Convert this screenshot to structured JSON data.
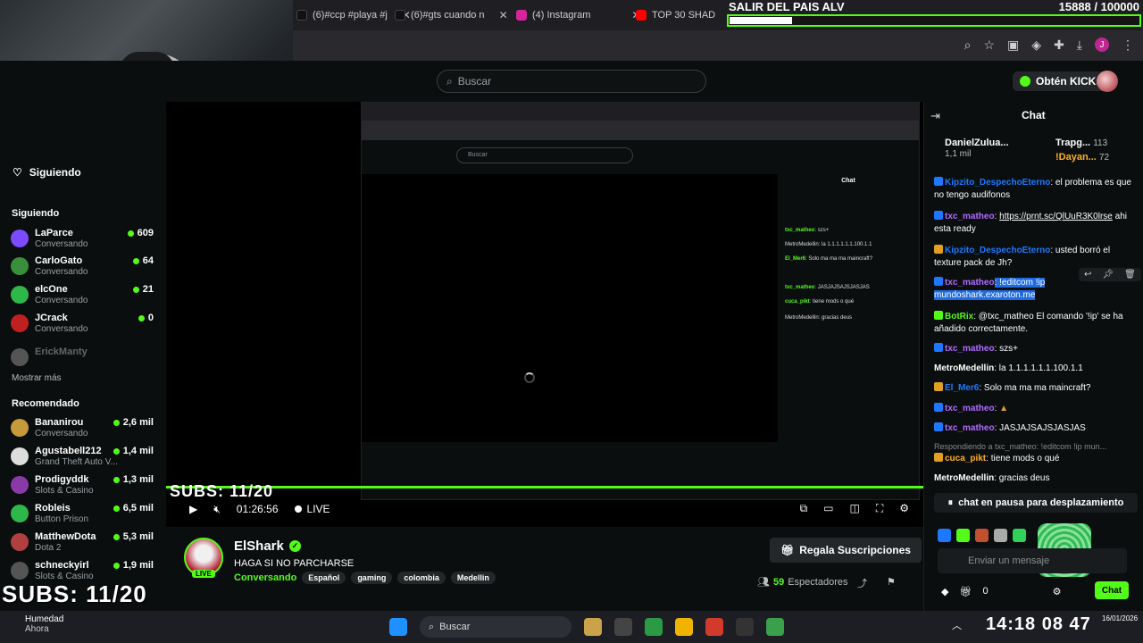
{
  "browser": {
    "tabs": [
      {
        "label": "(6)#ccp #playa #j",
        "color": "#111"
      },
      {
        "label": "(6)#gts cuando n",
        "color": "#111"
      },
      {
        "label": "(4) Instagram",
        "color": "#d6249f"
      },
      {
        "label": "TOP 30 SHAD",
        "color": "#ff0000"
      }
    ],
    "avatar_letter": "J"
  },
  "overlay": {
    "goal_title": "SALIR DEL PAIS ALV",
    "goal_count": "15888 / 100000"
  },
  "header": {
    "search_placeholder": "Buscar",
    "get_kicks": "Obtén KICKs"
  },
  "sidebar": {
    "following_header": "Siguiendo",
    "following_title": "Siguiendo",
    "following": [
      {
        "name": "LaParce",
        "sub": "Conversando",
        "count": "609",
        "color": "#7b4bff"
      },
      {
        "name": "CarloGato",
        "sub": "Conversando",
        "count": "64",
        "color": "#3a8f3a"
      },
      {
        "name": "elcOne",
        "sub": "Conversando",
        "count": "21",
        "color": "#2fb84a"
      },
      {
        "name": "JCrack",
        "sub": "Conversando",
        "count": "0",
        "color": "#c02020"
      },
      {
        "name": "ErickManty",
        "sub": "",
        "count": "",
        "color": "#555"
      }
    ],
    "show_more": "Mostrar más",
    "recommended_title": "Recomendado",
    "recommended": [
      {
        "name": "Bananirou",
        "sub": "Conversando",
        "count": "2,6 mil",
        "color": "#c49a3a"
      },
      {
        "name": "Agustabell212",
        "sub": "Grand Theft Auto V...",
        "count": "1,4 mil",
        "color": "#ddd"
      },
      {
        "name": "Prodigyddk",
        "sub": "Slots & Casino",
        "count": "1,3 mil",
        "color": "#8a3aa8"
      },
      {
        "name": "Robleis",
        "sub": "Button Prison",
        "count": "6,5 mil",
        "color": "#2fb84a"
      },
      {
        "name": "MatthewDota",
        "sub": "Dota 2",
        "count": "5,3 mil",
        "color": "#b04040"
      },
      {
        "name": "schneckyirl",
        "sub": "Slots & Casino",
        "count": "1,9 mil",
        "color": "#555"
      }
    ]
  },
  "player": {
    "subs_text": "SUBS: 11/20",
    "time": "01:26:56",
    "live": "LIVE"
  },
  "stream": {
    "name": "ElShark",
    "title": "HAGA SI NO PARCHARSE",
    "category": "Conversando",
    "tags": [
      "Español",
      "gaming",
      "colombia",
      "Medellin"
    ],
    "gift_button": "Regala Suscripciones",
    "viewers": "59",
    "viewers_label": "Espectadores",
    "live_badge": "LIVE",
    "subs_overlay": "SUBS: 11/20"
  },
  "chat": {
    "title": "Chat",
    "donors": [
      {
        "name": "DanielZulua...",
        "amount": "1,1 mil"
      },
      {
        "name": "Trapg...",
        "amount": "113"
      },
      {
        "name": "!Dayan...",
        "amount": "72"
      }
    ],
    "messages": [
      {
        "user": "Kipzito_DespechoEterno",
        "text": ": el problema es que no tengo audifonos",
        "ucolor": "#1e78ff"
      },
      {
        "user": "txc_matheo",
        "text": ": ",
        "link": "https://prnt.sc/QlUuR3K0lrse",
        "after": " ahi esta ready",
        "ucolor": "#b06bff"
      },
      {
        "user": "Kipzito_DespechoEterno",
        "text": ": usted borró el texture pack de Jh?",
        "ucolor": "#1e78ff"
      },
      {
        "user": "txc_matheo",
        "text": ": !editcom !ip mundoshark.exaroton.me",
        "ucolor": "#b06bff"
      },
      {
        "user": "BotRix",
        "text": ": @txc_matheo El comando '!ip' se ha añadido correctamente.",
        "ucolor": "#53fc18"
      },
      {
        "user": "txc_matheo",
        "text": ": szs+",
        "ucolor": "#b06bff"
      },
      {
        "user": "MetroMedellin",
        "text": ": la 1.1.1.1.1.1.100.1.1",
        "ucolor": "#ffffff"
      },
      {
        "user": "El_Mer6",
        "text": ": Solo ma ma ma maincraft?",
        "ucolor": "#1e78ff"
      },
      {
        "user": "txc_matheo",
        "text": ": ",
        "ucolor": "#b06bff"
      },
      {
        "user": "txc_matheo",
        "text": ": JASJAJSAJSJASJAS",
        "ucolor": "#b06bff"
      },
      {
        "user": "",
        "text": "Respondiendo a txc_matheo: !editcom !ip mun...",
        "ucolor": "#888"
      },
      {
        "user": "cuca_pikt",
        "text": ": tiene mods o qué",
        "ucolor": "#ffb020"
      },
      {
        "user": "MetroMedellin",
        "text": ": gracias deus",
        "ucolor": "#ffffff"
      }
    ],
    "paused": "chat en pausa para desplazamiento",
    "input_placeholder": "Enviar un mensaje",
    "kicks_count": "0",
    "send_label": "Chat"
  },
  "taskbar": {
    "weather_title": "Humedad",
    "weather_sub": "Ahora",
    "search": "Buscar",
    "clock_big": "14:18 08 47",
    "clock_date": "16/01/2026"
  }
}
